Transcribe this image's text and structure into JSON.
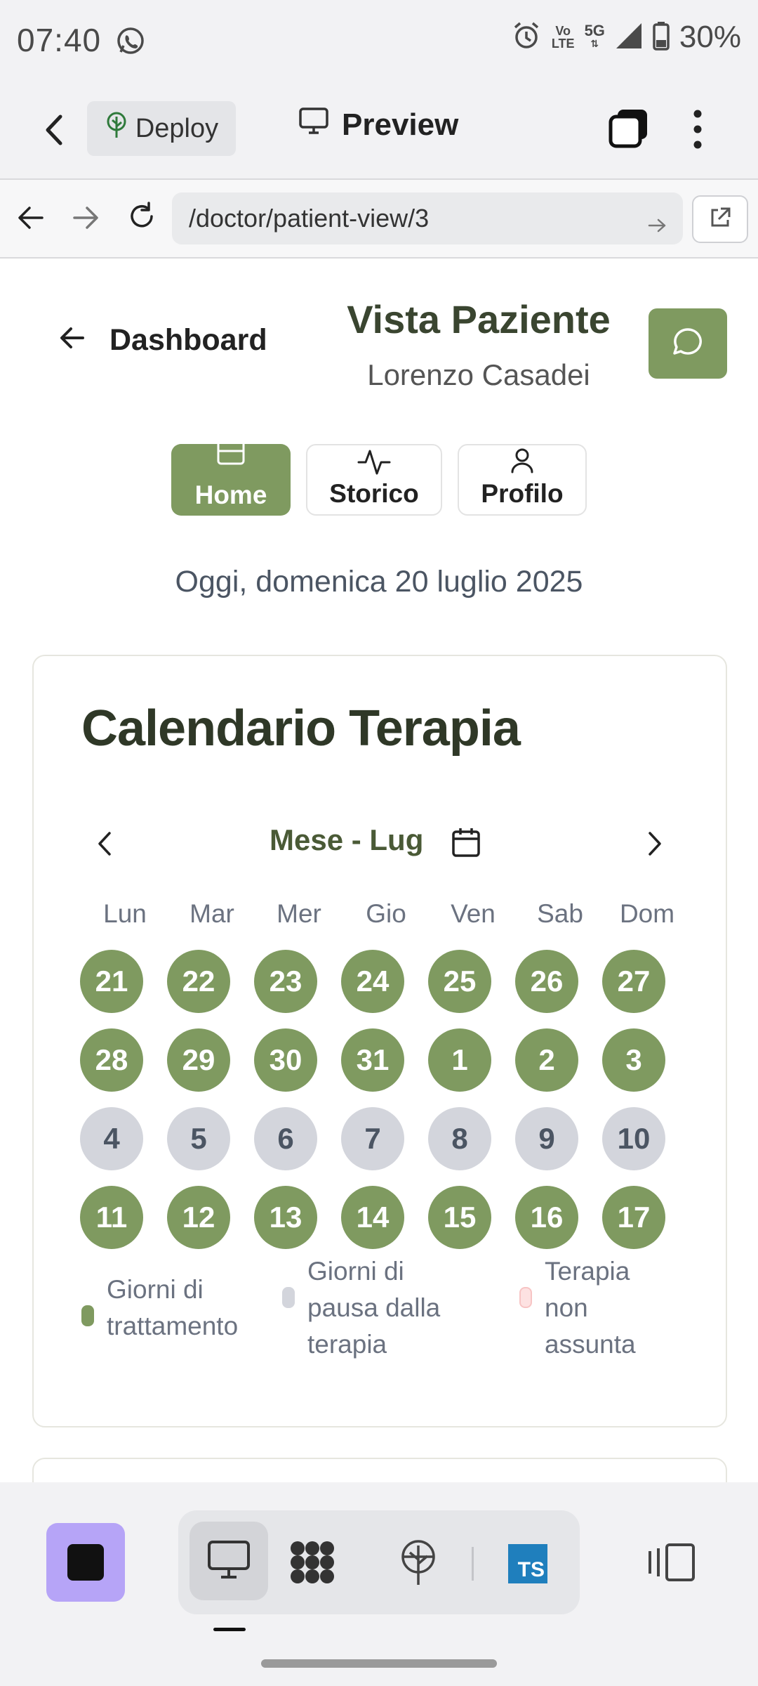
{
  "status_bar": {
    "time": "07:40",
    "volte_top": "Vo",
    "volte_bottom": "LTE",
    "net_type": "5G",
    "battery": "30%"
  },
  "app_header": {
    "deploy_label": "Deploy",
    "preview_label": "Preview"
  },
  "browser": {
    "url": "/doctor/patient-view/3"
  },
  "page": {
    "back_label": "Dashboard",
    "title": "Vista Paziente",
    "patient_name": "Lorenzo Casadei",
    "tabs": [
      {
        "label": "Home",
        "active": true
      },
      {
        "label": "Storico",
        "active": false
      },
      {
        "label": "Profilo",
        "active": false
      }
    ],
    "today": "Oggi, domenica 20 luglio 2025"
  },
  "calendar": {
    "title": "Calendario Terapia",
    "month_label": "Mese - Lug",
    "weekdays": [
      "Lun",
      "Mar",
      "Mer",
      "Gio",
      "Ven",
      "Sab",
      "Dom"
    ],
    "days": [
      {
        "n": "21",
        "status": "treatment"
      },
      {
        "n": "22",
        "status": "treatment"
      },
      {
        "n": "23",
        "status": "treatment"
      },
      {
        "n": "24",
        "status": "treatment"
      },
      {
        "n": "25",
        "status": "treatment"
      },
      {
        "n": "26",
        "status": "treatment"
      },
      {
        "n": "27",
        "status": "treatment"
      },
      {
        "n": "28",
        "status": "treatment"
      },
      {
        "n": "29",
        "status": "treatment"
      },
      {
        "n": "30",
        "status": "treatment"
      },
      {
        "n": "31",
        "status": "treatment"
      },
      {
        "n": "1",
        "status": "treatment"
      },
      {
        "n": "2",
        "status": "treatment"
      },
      {
        "n": "3",
        "status": "treatment"
      },
      {
        "n": "4",
        "status": "pause"
      },
      {
        "n": "5",
        "status": "pause"
      },
      {
        "n": "6",
        "status": "pause"
      },
      {
        "n": "7",
        "status": "pause"
      },
      {
        "n": "8",
        "status": "pause"
      },
      {
        "n": "9",
        "status": "pause"
      },
      {
        "n": "10",
        "status": "pause"
      },
      {
        "n": "11",
        "status": "treatment"
      },
      {
        "n": "12",
        "status": "treatment"
      },
      {
        "n": "13",
        "status": "treatment"
      },
      {
        "n": "14",
        "status": "treatment"
      },
      {
        "n": "15",
        "status": "treatment"
      },
      {
        "n": "16",
        "status": "treatment"
      },
      {
        "n": "17",
        "status": "treatment"
      }
    ],
    "legend": {
      "treatment_line1": "Giorni di",
      "treatment_line2": "trattamento",
      "pause_line1": "Giorni di",
      "pause_line2": "pausa dalla",
      "pause_line3": "terapia",
      "missed_line1": "Terapia",
      "missed_line2": "non",
      "missed_line3": "assunta"
    }
  },
  "bottom_bar": {
    "ts_badge": "TS"
  },
  "colors": {
    "accent": "#7f9a60",
    "pause": "#d3d5dc",
    "missed": "#fde2e2",
    "title_dark": "#2f3827",
    "purple": "#b6a4f7"
  }
}
